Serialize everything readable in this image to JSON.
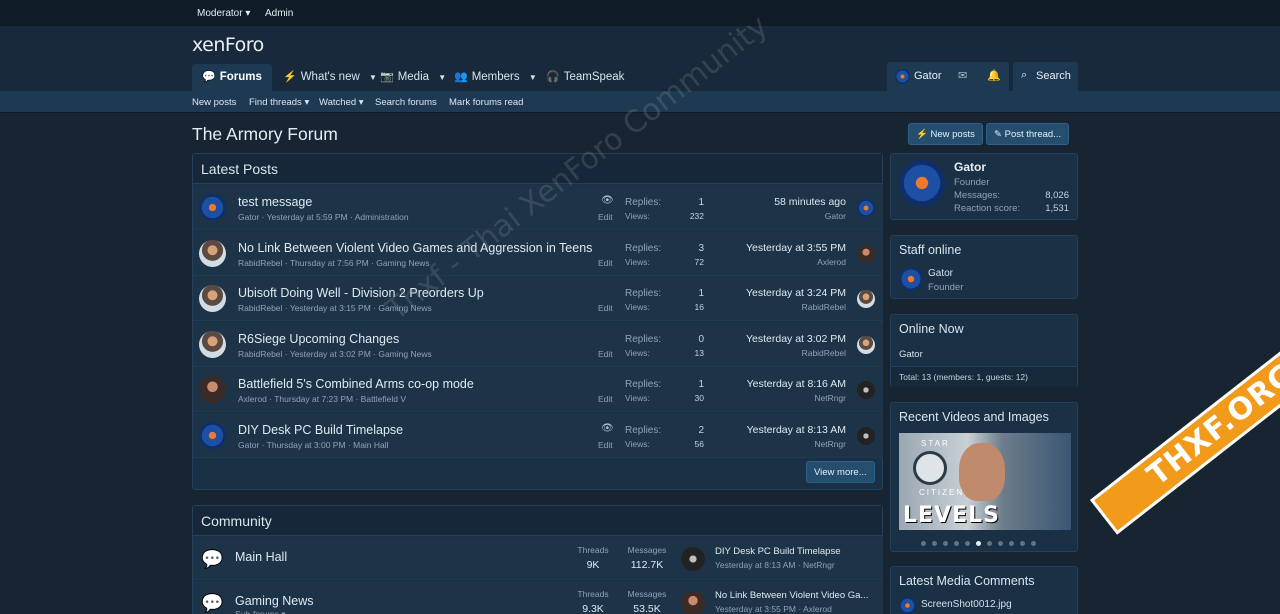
{
  "staffbar": {
    "moderator": "Moderator ▾",
    "admin": "Admin"
  },
  "logo": "xenForo",
  "nav": {
    "tabs": [
      {
        "label": "Forums",
        "icon": "comments-icon"
      },
      {
        "label": "What's new",
        "icon": "bolt-icon"
      },
      {
        "label": "Media",
        "icon": "camera-icon"
      },
      {
        "label": "Members",
        "icon": "users-icon"
      },
      {
        "label": "TeamSpeak",
        "icon": "headset-icon"
      }
    ],
    "user": "Gator",
    "search": "Search"
  },
  "subnav": [
    "New posts",
    "Find threads ▾",
    "Watched ▾",
    "Search forums",
    "Mark forums read"
  ],
  "page": {
    "title": "The Armory Forum",
    "new_posts_btn": "New posts",
    "post_thread_btn": "Post thread..."
  },
  "latest": {
    "heading": "Latest Posts",
    "replies_label": "Replies:",
    "views_label": "Views:",
    "edit_label": "Edit",
    "view_more": "View more...",
    "rows": [
      {
        "title": "test message",
        "meta": "Gator · Yesterday at 5:59 PM · Administration",
        "replies": "1",
        "views": "232",
        "last": "58 minutes ago",
        "last_user": "Gator",
        "watched": true
      },
      {
        "title": "No Link Between Violent Video Games and Aggression in Teens",
        "meta": "RabidRebel · Thursday at 7:56 PM · Gaming News",
        "replies": "3",
        "views": "72",
        "last": "Yesterday at 3:55 PM",
        "last_user": "Axlerod",
        "watched": false
      },
      {
        "title": "Ubisoft Doing Well - Division 2 Preorders Up",
        "meta": "RabidRebel · Yesterday at 3:15 PM · Gaming News",
        "replies": "1",
        "views": "16",
        "last": "Yesterday at 3:24 PM",
        "last_user": "RabidRebel",
        "watched": false
      },
      {
        "title": "R6Siege Upcoming Changes",
        "meta": "RabidRebel · Yesterday at 3:02 PM · Gaming News",
        "replies": "0",
        "views": "13",
        "last": "Yesterday at 3:02 PM",
        "last_user": "RabidRebel",
        "watched": false
      },
      {
        "title": "Battlefield 5's Combined Arms co-op mode",
        "meta": "Axlerod · Thursday at 7:23 PM · Battlefield V",
        "replies": "1",
        "views": "30",
        "last": "Yesterday at 8:16 AM",
        "last_user": "NetRngr",
        "watched": false
      },
      {
        "title": "DIY Desk PC Build Timelapse",
        "meta": "Gator · Thursday at 3:00 PM · Main Hall",
        "replies": "2",
        "views": "56",
        "last": "Yesterday at 8:13 AM",
        "last_user": "NetRngr",
        "watched": true
      }
    ]
  },
  "community": {
    "heading": "Community",
    "threads_label": "Threads",
    "messages_label": "Messages",
    "rows": [
      {
        "name": "Main Hall",
        "sub": "",
        "threads": "9K",
        "messages": "112.7K",
        "last_title": "DIY Desk PC Build Timelapse",
        "last_meta": "Yesterday at 8:13 AM · NetRngr"
      },
      {
        "name": "Gaming News",
        "sub": "Sub-forums ▾",
        "threads": "9.3K",
        "messages": "53.5K",
        "last_title": "No Link Between Violent Video Ga...",
        "last_meta": "Yesterday at 3:55 PM · Axlerod"
      }
    ]
  },
  "sidebar": {
    "profile": {
      "name": "Gator",
      "role": "Founder",
      "messages_label": "Messages:",
      "messages": "8,026",
      "reaction_label": "Reaction score:",
      "reaction": "1,531"
    },
    "staff": {
      "heading": "Staff online",
      "name": "Gator",
      "role": "Founder"
    },
    "online": {
      "heading": "Online Now",
      "user": "Gator",
      "total": "Total: 13 (members: 1, guests: 12)"
    },
    "videos": {
      "heading": "Recent Videos and Images",
      "caption": "LEVELS",
      "sub": "CITIZEN",
      "star": "STAR"
    },
    "comments": {
      "heading": "Latest Media Comments",
      "item": "ScreenShot0012.jpg"
    }
  },
  "watermark": {
    "text": "Thxf - Thai XenForo Community",
    "ribbon": "THXF.ORG"
  }
}
